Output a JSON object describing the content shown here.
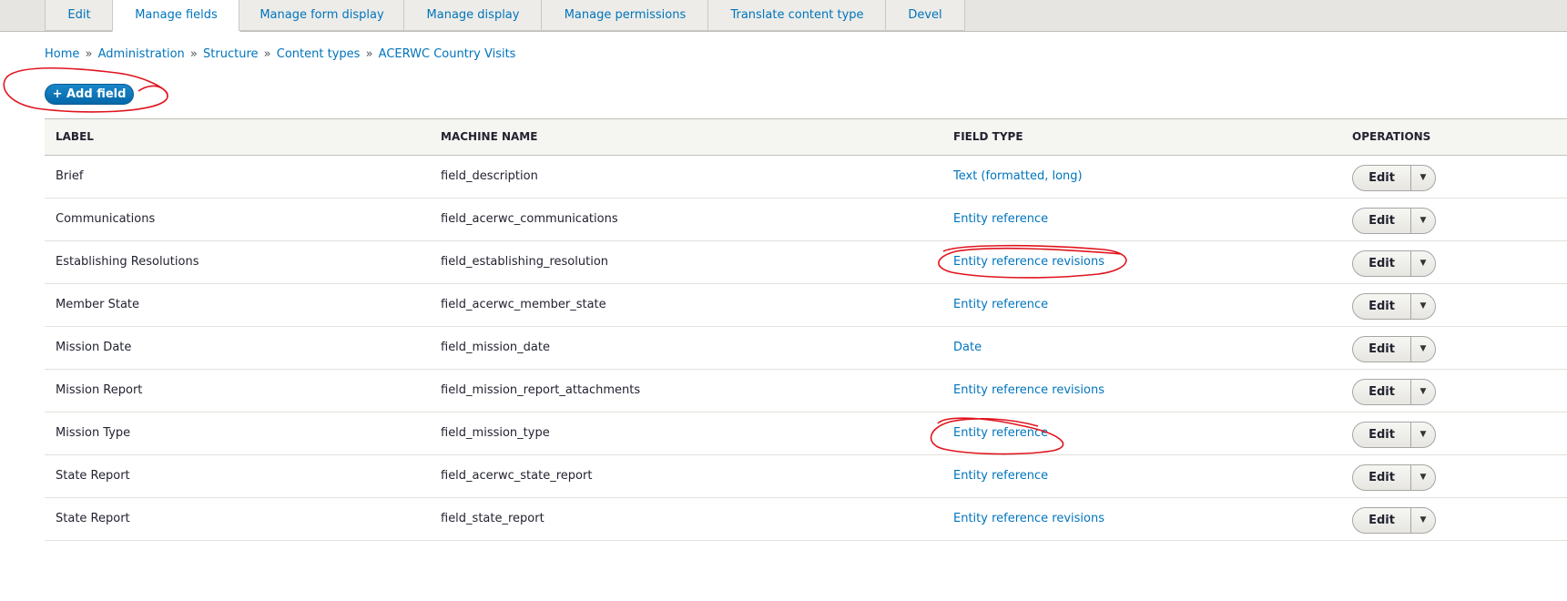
{
  "tabs": [
    {
      "label": "Edit",
      "active": false
    },
    {
      "label": "Manage fields",
      "active": true
    },
    {
      "label": "Manage form display",
      "active": false
    },
    {
      "label": "Manage display",
      "active": false
    },
    {
      "label": "Manage permissions",
      "active": false
    },
    {
      "label": "Translate content type",
      "active": false
    },
    {
      "label": "Devel",
      "active": false
    }
  ],
  "breadcrumb": {
    "separator": "»",
    "items": [
      "Home",
      "Administration",
      "Structure",
      "Content types",
      "ACERWC Country Visits"
    ]
  },
  "add_field_label": "+ Add field",
  "table": {
    "headers": [
      "LABEL",
      "MACHINE NAME",
      "FIELD TYPE",
      "OPERATIONS"
    ],
    "rows": [
      {
        "label": "Brief",
        "machine_name": "field_description",
        "field_type": "Text (formatted, long)",
        "operation": "Edit"
      },
      {
        "label": "Communications",
        "machine_name": "field_acerwc_communications",
        "field_type": "Entity reference",
        "operation": "Edit"
      },
      {
        "label": "Establishing Resolutions",
        "machine_name": "field_establishing_resolution",
        "field_type": "Entity reference revisions",
        "operation": "Edit"
      },
      {
        "label": "Member State",
        "machine_name": "field_acerwc_member_state",
        "field_type": "Entity reference",
        "operation": "Edit"
      },
      {
        "label": "Mission Date",
        "machine_name": "field_mission_date",
        "field_type": "Date",
        "operation": "Edit"
      },
      {
        "label": "Mission Report",
        "machine_name": "field_mission_report_attachments",
        "field_type": "Entity reference revisions",
        "operation": "Edit"
      },
      {
        "label": "Mission Type",
        "machine_name": "field_mission_type",
        "field_type": "Entity reference",
        "operation": "Edit"
      },
      {
        "label": "State Report",
        "machine_name": "field_acerwc_state_report",
        "field_type": "Entity reference",
        "operation": "Edit"
      },
      {
        "label": "State Report",
        "machine_name": "field_state_report",
        "field_type": "Entity reference revisions",
        "operation": "Edit"
      }
    ]
  },
  "colors": {
    "link": "#0074bd",
    "primary_button": "#0468a9",
    "annotation": "#e0141e"
  },
  "icons": {
    "dropdown_toggle": "caret-down-icon"
  }
}
